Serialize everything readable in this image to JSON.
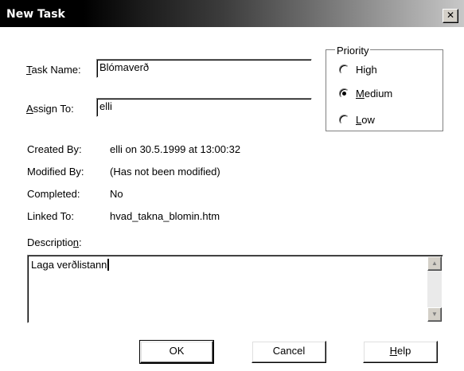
{
  "window": {
    "title": "New Task",
    "close_glyph": "✕"
  },
  "form": {
    "task_name": {
      "label_mnemonic": "T",
      "label_rest": "ask Name:",
      "value": "Blómaverð"
    },
    "assign_to": {
      "label_mnemonic": "A",
      "label_rest": "ssign To:",
      "value": "elli"
    }
  },
  "priority": {
    "legend": "Priority",
    "options": [
      {
        "pre": "Hi",
        "mnemonic": "g",
        "post": "h",
        "checked": false
      },
      {
        "pre": "",
        "mnemonic": "M",
        "post": "edium",
        "checked": true
      },
      {
        "pre": "",
        "mnemonic": "L",
        "post": "ow",
        "checked": false
      }
    ]
  },
  "info": {
    "created_by": {
      "label": "Created By:",
      "value": "elli on 30.5.1999 at 13:00:32"
    },
    "modified_by": {
      "label": "Modified By:",
      "value": "(Has not been modified)"
    },
    "completed": {
      "label": "Completed:",
      "value": "No"
    },
    "linked_to": {
      "label": "Linked To:",
      "value": "hvad_takna_blomin.htm"
    }
  },
  "description": {
    "label_pre": "Descriptio",
    "label_mnemonic": "n",
    "label_post": ":",
    "value": "Laga verðlistann"
  },
  "buttons": {
    "ok": "OK",
    "cancel": "Cancel",
    "help_mnemonic": "H",
    "help_rest": "elp"
  },
  "icons": {
    "scroll_up": "▲",
    "scroll_down": "▼"
  }
}
